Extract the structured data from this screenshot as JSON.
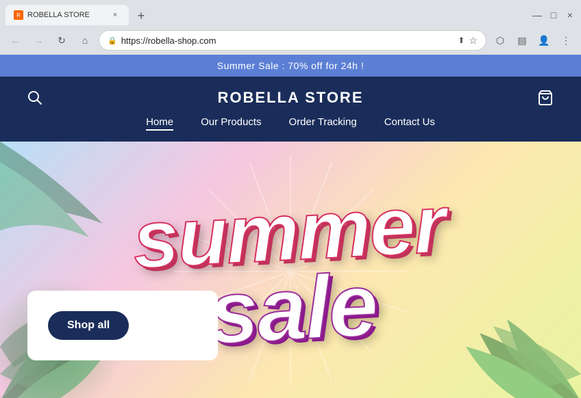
{
  "browser": {
    "tab": {
      "favicon_label": "R",
      "title": "ROBELLA STORE",
      "close_icon": "×"
    },
    "new_tab_icon": "+",
    "window_controls": {
      "minimize": "—",
      "maximize": "□",
      "close": "×"
    },
    "nav": {
      "back_icon": "←",
      "forward_icon": "→",
      "reload_icon": "↻",
      "home_icon": "⌂",
      "url": "https://robella-shop.com",
      "bookmark_icon": "☆",
      "extensions_icon": "⬡",
      "sidebar_icon": "▤",
      "profile_icon": "👤",
      "menu_icon": "⋮"
    }
  },
  "website": {
    "announcement": {
      "text": "Summer Sale : 70% off for 24h !"
    },
    "header": {
      "store_name": "ROBELLA STORE",
      "search_icon": "search",
      "cart_icon": "cart"
    },
    "nav_menu": {
      "items": [
        {
          "label": "Home",
          "active": true
        },
        {
          "label": "Our Products",
          "active": false
        },
        {
          "label": "Order Tracking",
          "active": false
        },
        {
          "label": "Contact Us",
          "active": false
        }
      ]
    },
    "hero": {
      "summer_text": "summer",
      "sale_text": "sale",
      "cta_button": "Shop all"
    }
  }
}
